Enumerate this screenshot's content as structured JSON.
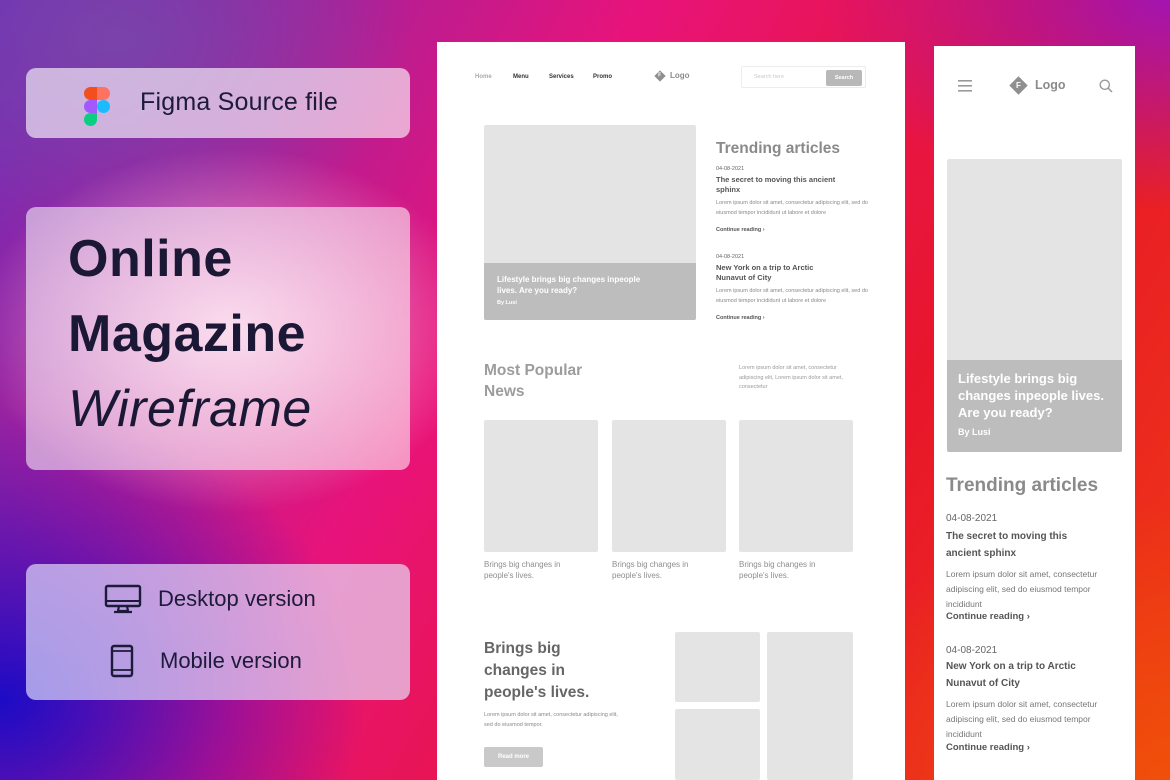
{
  "promo": {
    "source_label": "Figma Source file",
    "title_line1": "Online",
    "title_line2": "Magazine",
    "title_line3": "Wireframe",
    "desktop_label": "Desktop version",
    "mobile_label": "Mobile version"
  },
  "desktop": {
    "nav": [
      "Home",
      "Menu",
      "Services",
      "Promo"
    ],
    "logo": "Logo",
    "logo_letter": "F",
    "search_placeholder": "Search here",
    "search_button": "Search",
    "hero_title": "Lifestyle brings big changes inpeople lives. Are you ready?",
    "hero_byline": "By Lusi",
    "trending_title": "Trending articles",
    "articles": [
      {
        "date": "04-08-2021",
        "title": "The secret to moving this ancient sphinx",
        "excerpt": "Lorem ipsum dolor sit amet, consectetur adipiscing elit, sed do eiusmod tempor incididunt ut labore et dolore",
        "cta": "Continue reading"
      },
      {
        "date": "04-08-2021",
        "title": "New York on a trip to Arctic Nunavut of City",
        "excerpt": "Lorem ipsum dolor sit amet, consectetur adipiscing elit, sed do eiusmod tempor incididunt ut labore et dolore",
        "cta": "Continue reading"
      }
    ],
    "popular_title_line1": "Most Popular",
    "popular_title_line2": "News",
    "popular_desc": "Lorem ipsum dolor sit amet, consectetur adipiscing elit, Lorem ipsum dolor sit amet, consectetur",
    "cards": [
      {
        "caption": "Brings big changes in people's lives."
      },
      {
        "caption": "Brings big changes in people's lives."
      },
      {
        "caption": "Brings big changes in people's lives."
      }
    ],
    "bottom_title": "Brings big changes in people's lives.",
    "bottom_desc": "Lorem ipsum dolor sit amet, consectetur adipiscing elit, sed do eiusmod tempor.",
    "read_more": "Read more"
  },
  "mobile": {
    "logo": "Logo",
    "logo_letter": "F",
    "hero_title": "Lifestyle brings big changes inpeople lives. Are you ready?",
    "hero_byline": "By Lusi",
    "trending_title": "Trending articles",
    "articles": [
      {
        "date": "04-08-2021",
        "title": "The secret to moving this ancient sphinx",
        "excerpt": "Lorem ipsum dolor sit amet, consectetur adipiscing elit, sed do eiusmod tempor incididunt",
        "cta": "Continue reading"
      },
      {
        "date": "04-08-2021",
        "title": "New York on a trip to Arctic Nunavut of City",
        "excerpt": "Lorem ipsum dolor sit amet, consectetur adipiscing elit, sed do eiusmod tempor incididunt",
        "cta": "Continue reading"
      }
    ]
  }
}
